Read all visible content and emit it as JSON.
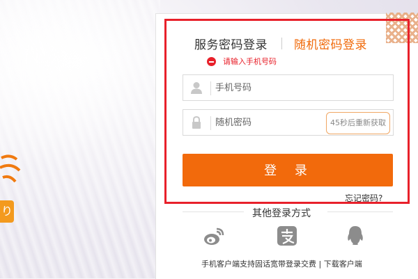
{
  "login": {
    "tabs": [
      {
        "label": "服务密码登录",
        "active": false
      },
      {
        "label": "随机密码登录",
        "active": true
      }
    ],
    "error_message": "请输入手机号码",
    "phone_placeholder": "手机号码",
    "password_placeholder": "随机密码",
    "resend_label": "45秒后重新获取",
    "submit_label": "登 录",
    "forgot_label": "忘记密码?",
    "other_methods_title": "其他登录方式",
    "social_icons": [
      "weibo-icon",
      "alipay-icon",
      "qq-icon"
    ],
    "footer_text": "手机客户端支持固话宽带登录交费 | 下载客户端"
  },
  "colors": {
    "accent": "#f26a0c",
    "error": "#e8202a",
    "highlight_border": "#e8202a"
  },
  "background": {
    "badge_text": "り"
  }
}
